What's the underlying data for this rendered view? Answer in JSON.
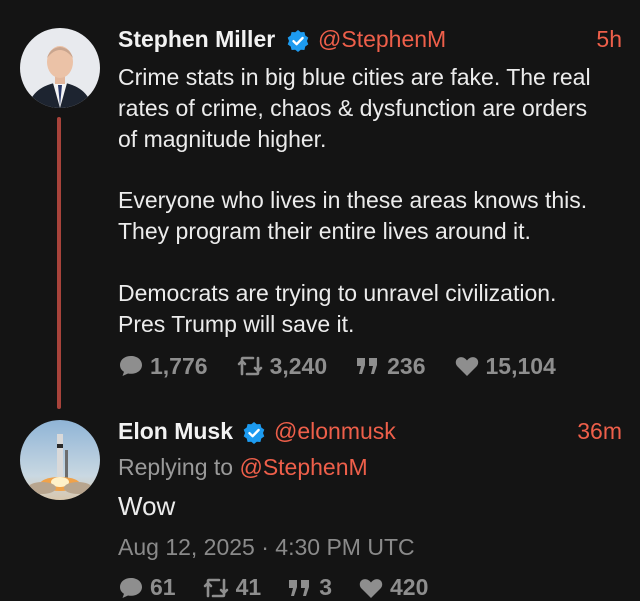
{
  "tweet1": {
    "author_name": "Stephen Miller",
    "handle": "@StephenM",
    "time": "5h",
    "lines": [
      "Crime stats in big blue cities are fake. The real",
      "rates of crime, chaos & dysfunction are orders",
      "of magnitude higher.",
      "Everyone who lives in these areas knows this.",
      "They program their entire lives around it.",
      "Democrats are trying to unravel civilization.",
      "Pres Trump will save it."
    ],
    "stats": {
      "replies": "1,776",
      "retweets": "3,240",
      "quotes": "236",
      "likes": "15,104"
    }
  },
  "tweet2": {
    "author_name": "Elon Musk",
    "handle": "@elonmusk",
    "time": "36m",
    "replying_prefix": "Replying to",
    "replying_to": "@StephenM",
    "text": "Wow",
    "timestamp": "Aug 12, 2025 · 4:30 PM UTC",
    "stats": {
      "replies": "61",
      "retweets": "41",
      "quotes": "3",
      "likes": "420"
    }
  },
  "icons": {
    "reply": "speech-bubble-icon",
    "retweet": "retweet-icon",
    "quote": "quote-icon",
    "like": "heart-icon",
    "verified": "verified-badge-icon"
  },
  "colors": {
    "background": "#141414",
    "accent": "#ee5f4a",
    "verified": "#1d9bf0",
    "thread_line": "#a8433b",
    "muted": "#8e8e8e"
  }
}
